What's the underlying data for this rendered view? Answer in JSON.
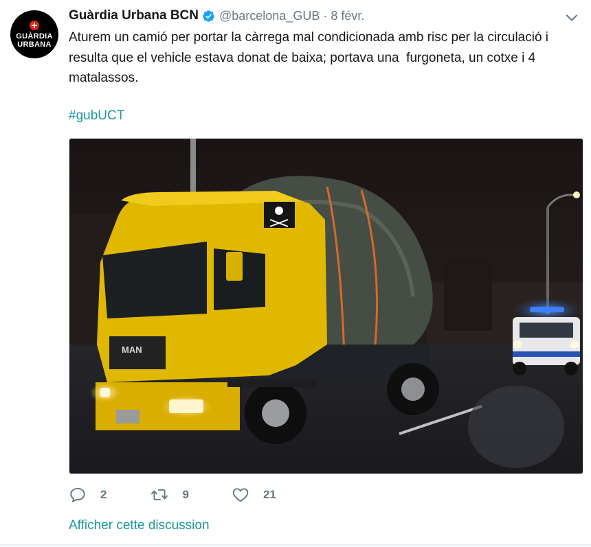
{
  "account": {
    "display_name": "Guàrdia Urbana BCN",
    "handle": "@barcelona_GUB",
    "date": "8 févr.",
    "avatar_line1": "GUÀRDIA",
    "avatar_line2": "URBANA",
    "verified": true
  },
  "tweet": {
    "text": "Aturem un camió per portar la càrrega mal condicionada amb risc per la circulació i resulta que el vehicle estava donat de baixa; portava una  furgoneta, un cotxe i 4 matalassos.",
    "hashtag": "#gubUCT"
  },
  "media": {
    "description_icon": "photo-truck-icon",
    "cab_brand": "MAN"
  },
  "actions": {
    "reply_count": "2",
    "retweet_count": "9",
    "like_count": "21"
  },
  "footer": {
    "show_thread": "Afficher cette discussion"
  },
  "colors": {
    "link": "#1b95a0",
    "secondary_text": "#657786",
    "verified": "#1da1f2",
    "avatar_bg": "#000000",
    "emblem_red": "#e2231a"
  }
}
